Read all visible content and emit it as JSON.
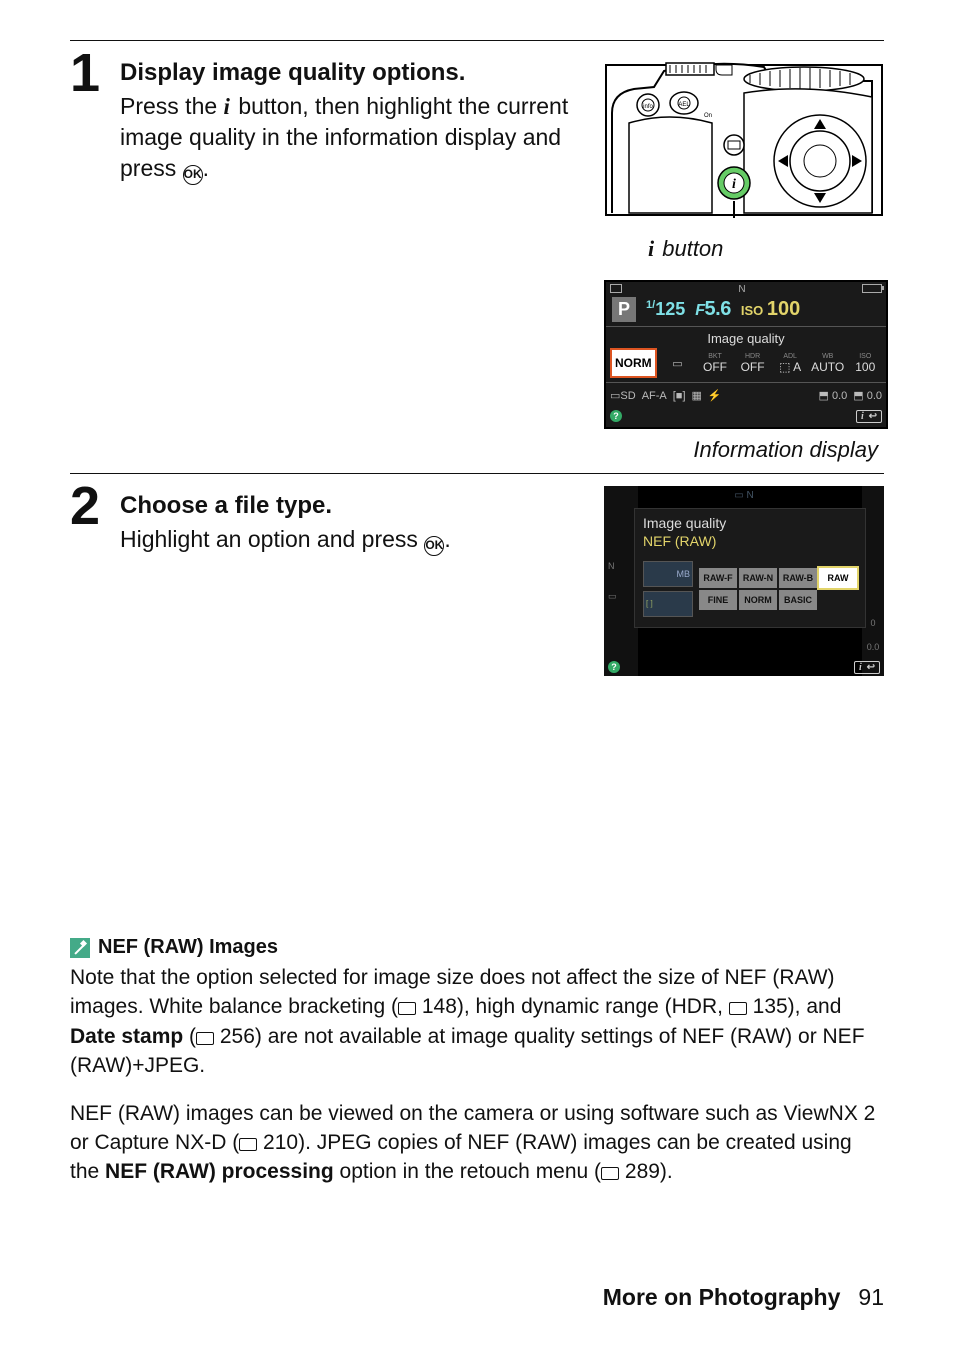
{
  "step1": {
    "num": "1",
    "title": "Display image quality options.",
    "line1a": "Press the ",
    "line1b": " button, then highlight the current image quality in the information display and press ",
    "line1c": ".",
    "button_caption_suffix": " button",
    "info_caption": "Information display"
  },
  "info_display": {
    "mode": "P",
    "shutter_pref": "1/",
    "shutter_val": "125",
    "aperture_pref": "F",
    "aperture_val": "5.6",
    "iso_label": "ISO",
    "iso_val": "100",
    "section_label": "Image quality",
    "norm": "NORM",
    "columns": [
      {
        "h": "",
        "v": ""
      },
      {
        "h": "BKT",
        "v": "OFF"
      },
      {
        "h": "HDR",
        "v": "OFF"
      },
      {
        "h": "ADL",
        "v": "⬚ A"
      },
      {
        "h": "WB",
        "v": "AUTO"
      },
      {
        "h": "ISO",
        "v": "100"
      }
    ],
    "bottom": [
      "SD",
      "AF-A",
      "[■]",
      "",
      "",
      "⬒ 0.0",
      "⬒ 0.0"
    ],
    "help": "?"
  },
  "step2": {
    "num": "2",
    "title": "Choose a file type.",
    "text_a": "Highlight an option and press ",
    "text_b": "."
  },
  "iq_screen": {
    "title": "Image quality",
    "current": "NEF (RAW)",
    "thumb1": "MB",
    "row1": [
      "RAW-F",
      "RAW-N",
      "RAW-B",
      "RAW"
    ],
    "row2": [
      "FINE",
      "NORM",
      "BASIC"
    ],
    "dim_left": [
      "N",
      ""
    ],
    "dim_right": [
      "0",
      "0.0"
    ],
    "help": "?"
  },
  "note": {
    "heading": "NEF (RAW) Images",
    "p1_a": "Note that the option selected for image size does not affect the size of NEF (RAW) images.  White balance bracketing (",
    "p1_ref1": " 148), high dynamic range (HDR, ",
    "p1_ref2": " 135), and ",
    "p1_bold": "Date stamp",
    "p1_b": " (",
    "p1_ref3": " 256) are not available at image quality settings of NEF (RAW) or NEF (RAW)+JPEG.",
    "p2_a": "NEF (RAW) images can be viewed on the camera or using software such as ViewNX 2 or Capture NX-D (",
    "p2_ref1": " 210).  JPEG copies of NEF (RAW) images can be created using the ",
    "p2_bold": "NEF (RAW) processing",
    "p2_b": " option in the retouch menu (",
    "p2_ref2": " 289)."
  },
  "footer": {
    "section": "More on Photography",
    "page": "91"
  },
  "ok_glyph": "OK",
  "i_glyph": "i",
  "i_return": "i ↩"
}
